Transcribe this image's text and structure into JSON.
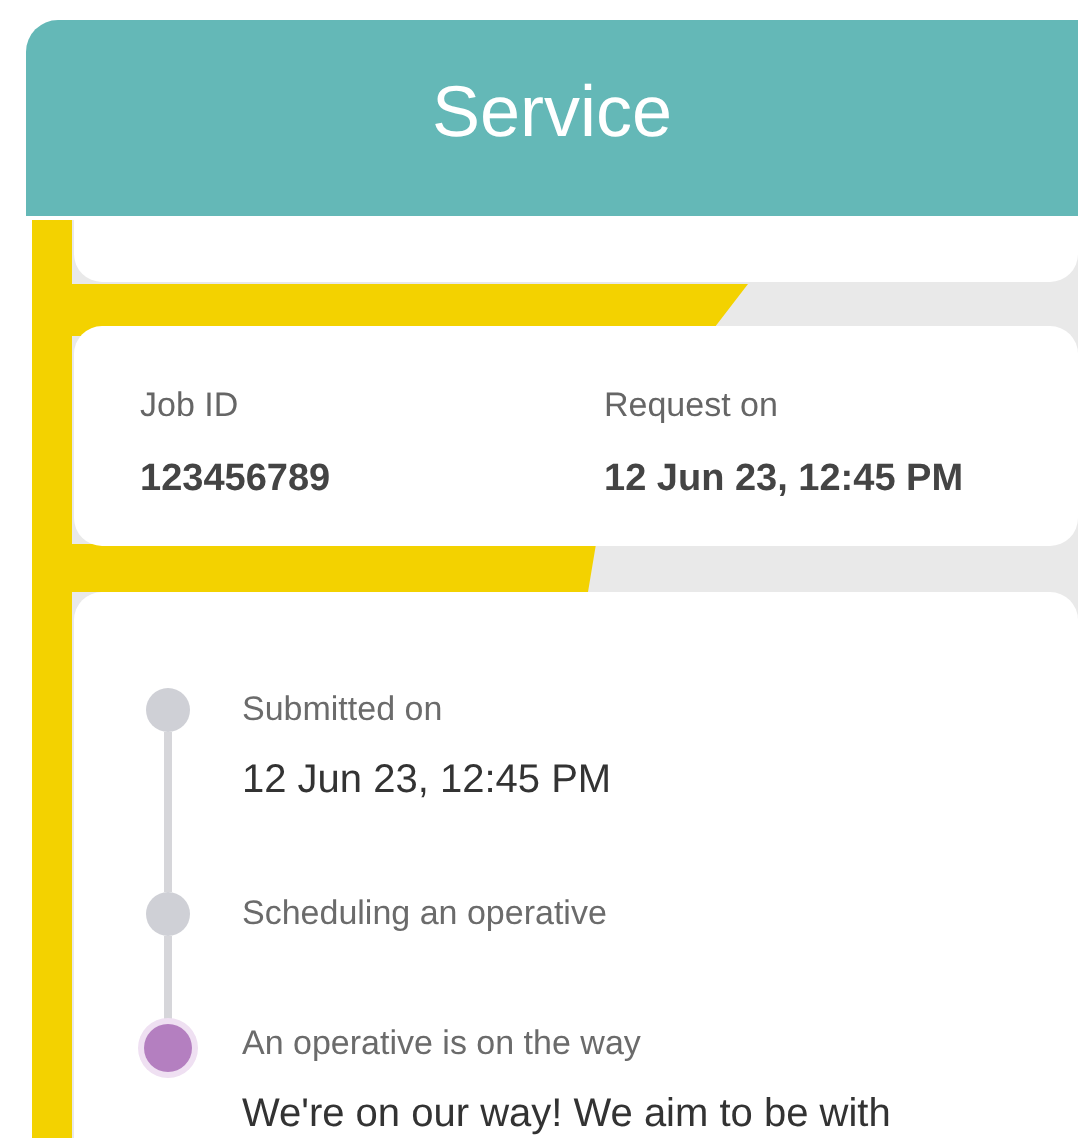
{
  "header": {
    "title": "Service"
  },
  "job": {
    "id_label": "Job ID",
    "id": "123456789",
    "request_label": "Request on",
    "request": "12 Jun 23, 12:45 PM"
  },
  "timeline": [
    {
      "label": "Submitted on",
      "detail": "12 Jun 23, 12:45 PM",
      "current": false
    },
    {
      "label": "Scheduling an operative",
      "current": false
    },
    {
      "label": "An operative is on the way",
      "detail": "We're on our way! We aim to be with",
      "current": true
    }
  ]
}
